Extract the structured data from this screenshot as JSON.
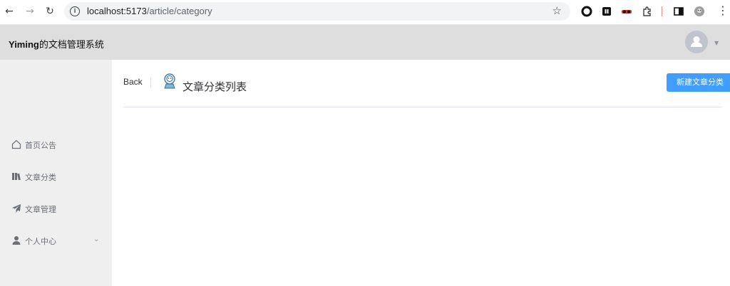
{
  "browser": {
    "url_host": "localhost:5173",
    "url_path": "/article/category",
    "back_icon": "←",
    "forward_icon": "→",
    "reload_icon": "↻",
    "star_icon": "☆",
    "menu_icon": "⋮"
  },
  "header": {
    "brand_bold": "Yiming",
    "brand_rest": "的文档管理系统"
  },
  "sidebar": {
    "items": [
      {
        "label": "首页公告",
        "icon": "home-icon"
      },
      {
        "label": "文章分类",
        "icon": "books-icon"
      },
      {
        "label": "文章管理",
        "icon": "send-icon"
      },
      {
        "label": "个人中心",
        "icon": "user-icon",
        "arrow": "⌄"
      }
    ]
  },
  "page": {
    "back_label": "Back",
    "title": "文章分类列表",
    "new_button": "新建文章分类"
  },
  "colors": {
    "primary": "#409eff",
    "header_bg": "#dedede",
    "sidebar_bg": "#efefef"
  }
}
